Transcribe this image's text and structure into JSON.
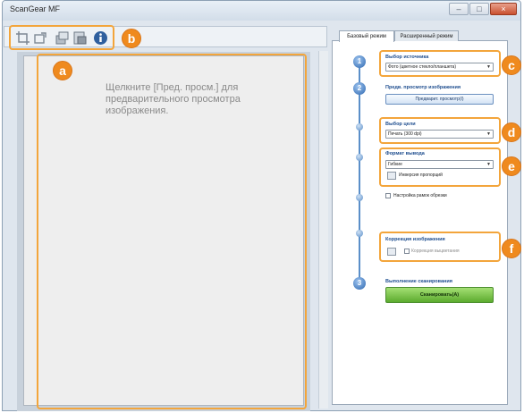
{
  "window": {
    "title": "ScanGear MF",
    "controls": [
      "–",
      "□",
      "×"
    ]
  },
  "toolbar": {
    "icons": [
      "crop-icon",
      "auto-crop-icon",
      "select-all-icon",
      "zoom-icon",
      "info-icon"
    ]
  },
  "callouts": {
    "a": "a",
    "b": "b",
    "c": "c",
    "d": "d",
    "e": "e",
    "f": "f"
  },
  "preview": {
    "hint": "Щелкните [Пред. просм.] для предварительного просмотра изображения."
  },
  "tabs": {
    "basic": "Базовый режим",
    "advanced": "Расширенный режим"
  },
  "steps": {
    "step1": "1",
    "step2": "2",
    "step3": "3"
  },
  "source": {
    "label": "Выбор источника",
    "value": "Фото (цветное стекло/планшета)"
  },
  "preview_section": {
    "label": "Предв. просмотр изображения",
    "button": "Предварит. просмотр(I)"
  },
  "destination": {
    "label": "Выбор цели",
    "value": "Печать (300 dpi)"
  },
  "output_format": {
    "label": "Формат вывода",
    "value": "Гибкие",
    "invert_label": "Инверсия пропорций"
  },
  "crop_frame": {
    "label": "Настройка рамок обрезки"
  },
  "correction": {
    "label": "Коррекция изображения",
    "option": "Коррекция выцветания"
  },
  "scan": {
    "label": "Выполнение сканирования",
    "button": "Сканировать(A)"
  }
}
